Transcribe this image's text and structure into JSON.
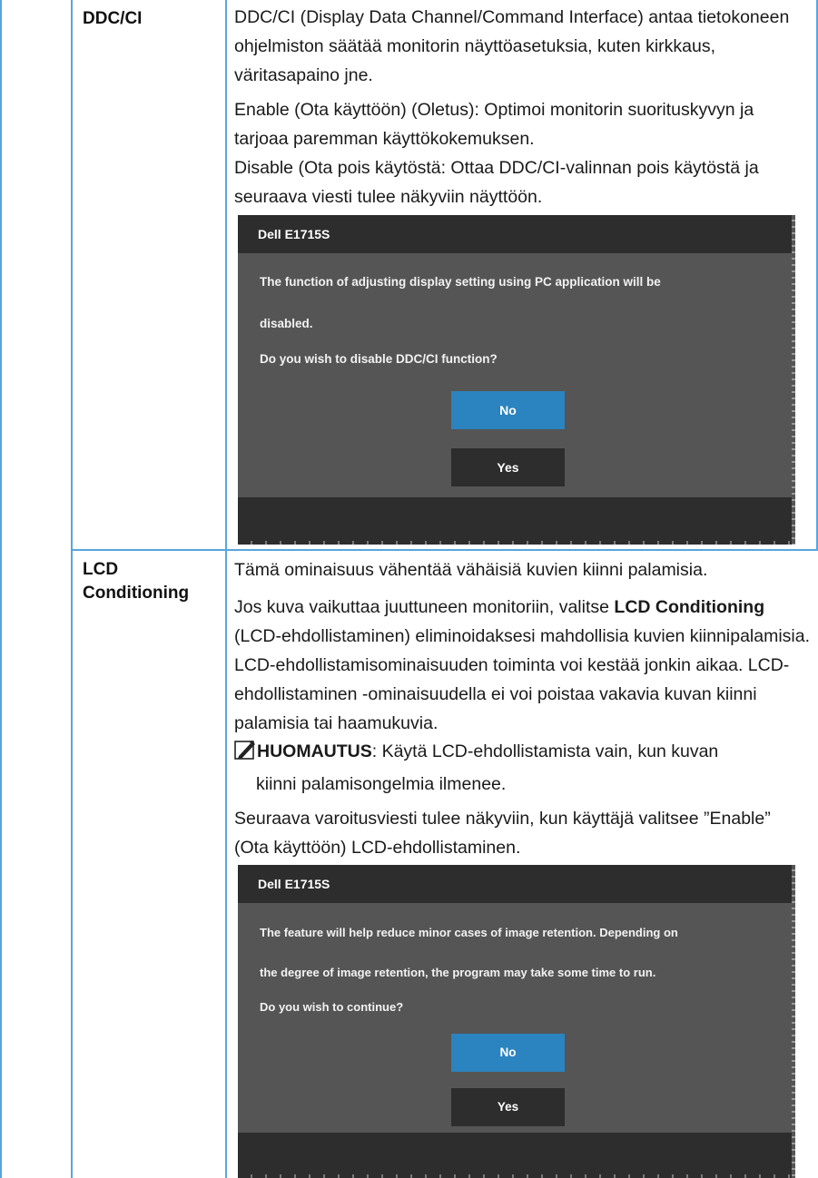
{
  "ddc": {
    "label": "DDC/CI",
    "description": "DDC/CI (Display Data Channel/Command Interface) antaa tietokoneen ohjelmiston säätää monitorin näyttöasetuksia, kuten kirkkaus, väritasapaino jne.",
    "enable_text": "Enable (Ota käyttöön) (Oletus): Optimoi monitorin suorituskyvyn ja tarjoaa paremman käyttökokemuksen.",
    "disable_text": "Disable (Ota pois käytöstä: Ottaa DDC/CI-valinnan pois käytöstä ja seuraava viesti tulee näkyviin näyttöön.",
    "dialog": {
      "title": "Dell E1715S",
      "line1": "The function of adjusting display setting using PC application will be",
      "line2": "disabled.",
      "question": "Do you wish to disable DDC/CI function?",
      "no_label": "No",
      "yes_label": "Yes"
    }
  },
  "lcd": {
    "label_line1": "LCD",
    "label_line2": "Conditioning",
    "intro": "Tämä ominaisuus vähentää vähäisiä kuvien kiinni palamisia.",
    "para_before": "Jos kuva vaikuttaa juuttuneen monitoriin, valitse ",
    "para_bold": "LCD Conditioning",
    "para_after": " (LCD-ehdollistaminen) eliminoidaksesi mahdollisia kuvien kiinnipalamisia. LCD-ehdollistamisominaisuuden toiminta voi kestää jonkin aikaa. LCD-ehdollistaminen -ominaisuudella ei voi poistaa vakavia kuvan kiinni palamisia tai haamukuvia.",
    "note_label": "HUOMAUTUS",
    "note_text": ": Käytä LCD-ehdollistamista vain, kun kuvan",
    "note_text2": "kiinni palamisongelmia ilmenee.",
    "warning_intro": "Seuraava varoitusviesti tulee näkyviin, kun käyttäjä valitsee ”Enable” (Ota käyttöön)  LCD-ehdollistaminen.",
    "dialog": {
      "title": "Dell E1715S",
      "line1": "The feature will help reduce minor cases of image retention. Depending on",
      "line2": "the degree of image retention, the program may take some time to run.",
      "question": "Do you wish to continue?",
      "no_label": "No",
      "yes_label": "Yes"
    }
  },
  "note_icon": "pencil-note-icon",
  "colors": {
    "table_border": "#58a6dc",
    "osd_body": "#555555",
    "osd_bar": "#2d2d2d",
    "osd_selected": "#2b83bf"
  }
}
